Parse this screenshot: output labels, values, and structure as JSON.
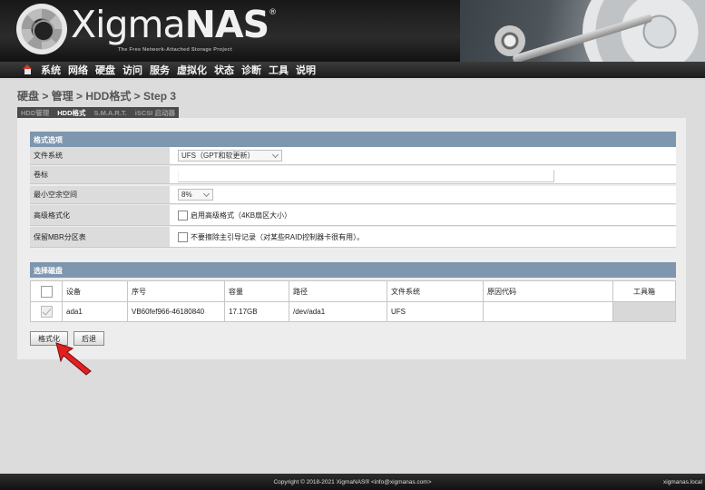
{
  "brand": {
    "name_light": "Xigma",
    "name_bold": "NAS",
    "mark": "®",
    "tagline": "The Free Network-Attached Storage Project"
  },
  "nav": {
    "home_icon": "home-icon",
    "items": [
      "系统",
      "网络",
      "硬盘",
      "访问",
      "服务",
      "虚拟化",
      "状态",
      "诊断",
      "工具",
      "说明"
    ]
  },
  "breadcrumb": "硬盘 > 管理 > HDD格式 > Step 3",
  "tabs": [
    {
      "label": "HDD管理",
      "active": false
    },
    {
      "label": "HDD格式",
      "active": true
    },
    {
      "label": "S.M.A.R.T.",
      "active": false
    },
    {
      "label": "iSCSI 启动器",
      "active": false
    }
  ],
  "format_section": {
    "title": "格式选项",
    "filesystem": {
      "label": "文件系统",
      "value": "UFS（GPT和软更新）"
    },
    "volume_label": {
      "label": "卷标",
      "value": ""
    },
    "min_free": {
      "label": "最小空余空间",
      "value": "8%"
    },
    "advanced": {
      "label": "高级格式化",
      "checkbox_text": "启用高级格式（4KB扇区大小）",
      "checked": false
    },
    "keep_mbr": {
      "label": "保留MBR分区表",
      "checkbox_text": "不要擦除主引导记录（对某些RAID控制器卡很有用）。",
      "checked": false
    }
  },
  "disk_section": {
    "title": "选择磁盘",
    "columns": [
      "",
      "设备",
      "序号",
      "容量",
      "路径",
      "文件系统",
      "原因代码",
      "工具箱"
    ],
    "rows": [
      {
        "checked": true,
        "device": "ada1",
        "serial": "VB60fef966-46180840",
        "size": "17.17GB",
        "path": "/dev/ada1",
        "fs": "UFS",
        "reason": "",
        "toolbox": ""
      }
    ]
  },
  "buttons": {
    "format": "格式化",
    "back": "后退"
  },
  "footer": {
    "copyright": "Copyright © 2018-2021 XigmaNAS® <info@xigmanas.com>",
    "hostname": "xigmanas.local"
  },
  "colors": {
    "section_header": "#7e96ae",
    "nav_bg": "#2a2a2a",
    "arrow": "#e02020"
  }
}
